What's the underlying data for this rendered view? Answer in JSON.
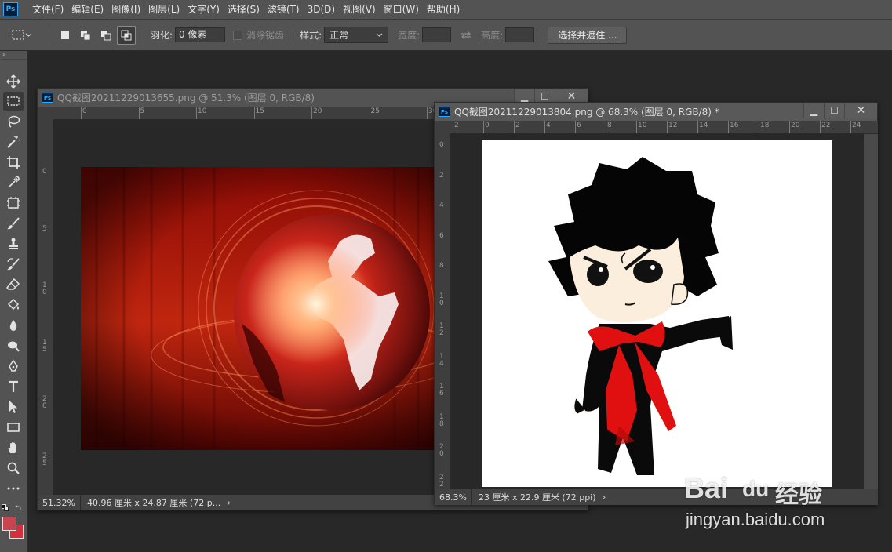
{
  "app": {
    "logo": "Ps"
  },
  "menu": [
    "文件(F)",
    "编辑(E)",
    "图像(I)",
    "图层(L)",
    "文字(Y)",
    "选择(S)",
    "滤镜(T)",
    "3D(D)",
    "视图(V)",
    "窗口(W)",
    "帮助(H)"
  ],
  "options": {
    "feather_label": "羽化:",
    "feather_value": "0 像素",
    "antialias_label": "消除锯齿",
    "style_label": "样式:",
    "style_value": "正常",
    "width_label": "宽度:",
    "height_label": "高度:",
    "select_mask_button": "选择并遮住 ..."
  },
  "doc1": {
    "title": "QQ截图20211229013655.png @ 51.3% (图层 0, RGB/8)",
    "zoom": "51.32%",
    "info": "40.96 厘米 x 24.87 厘米 (72 p...",
    "ruler_h": [
      "0",
      "5",
      "10",
      "15",
      "20",
      "25",
      "30"
    ],
    "ruler_v": [
      "0",
      "5",
      "1\n0",
      "1\n5",
      "2\n0",
      "2\n5"
    ]
  },
  "doc2": {
    "title": "QQ截图20211229013804.png @ 68.3% (图层 0, RGB/8) *",
    "zoom": "68.3%",
    "info": "23 厘米 x 22.9 厘米 (72 ppi)",
    "ruler_h": [
      "2",
      "0",
      "2",
      "4",
      "6",
      "8",
      "10",
      "12",
      "14",
      "16",
      "18",
      "20",
      "22",
      "24"
    ],
    "ruler_v": [
      "0",
      "2",
      "4",
      "6",
      "8",
      "1\n0",
      "1\n2",
      "1\n4",
      "1\n6",
      "1\n8",
      "2\n0",
      "2\n2"
    ]
  },
  "window_buttons": {
    "minimize": "▁",
    "maximize": "☐",
    "close": "✕"
  },
  "status_arrow": "›",
  "watermark": {
    "brand": "Bai",
    "brand2": "du",
    "cn": "经验",
    "url": "jingyan.baidu.com"
  },
  "colors": {
    "foreground": "#c9444f",
    "background": "#d32f3c",
    "accent": "#31a8ff"
  }
}
